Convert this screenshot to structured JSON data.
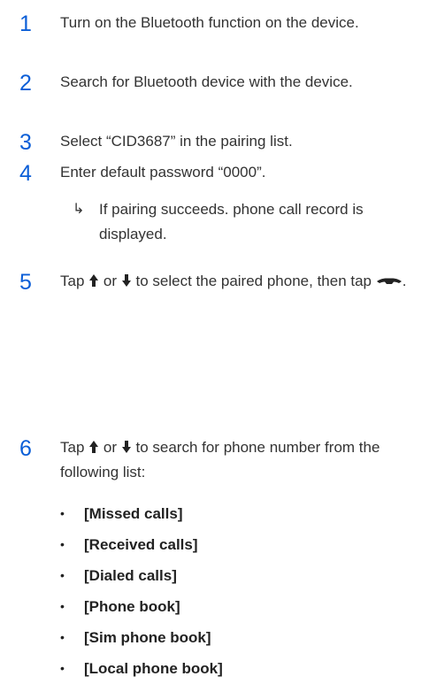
{
  "accent_color": "#0b5ed7",
  "steps": [
    {
      "number": "1",
      "text": "Turn on the Bluetooth function on the device."
    },
    {
      "number": "2",
      "text": "Search for Bluetooth device with the device."
    },
    {
      "number": "3",
      "text": "Select “CID3687” in the pairing list."
    },
    {
      "number": "4",
      "text": "Enter default password “0000”."
    },
    {
      "number": "5",
      "text_before": "Tap",
      "text_or": "or",
      "text_after": "to select the paired phone, then tap",
      "text_end": "."
    },
    {
      "number": "6",
      "text_before": "Tap",
      "text_or": "or",
      "text_after": "to search for phone number from the following list:"
    }
  ],
  "result": {
    "arrow": "↳",
    "text": "If pairing succeeds. phone call record is displayed."
  },
  "list_bullet": "•",
  "list_items": [
    "[Missed calls]",
    "[Received calls]",
    "[Dialed calls]",
    "[Phone book]",
    "[Sim phone book]",
    "[Local phone book]"
  ],
  "icons": {
    "up": "up-arrow-icon",
    "down": "down-arrow-icon",
    "call": "call-icon"
  }
}
